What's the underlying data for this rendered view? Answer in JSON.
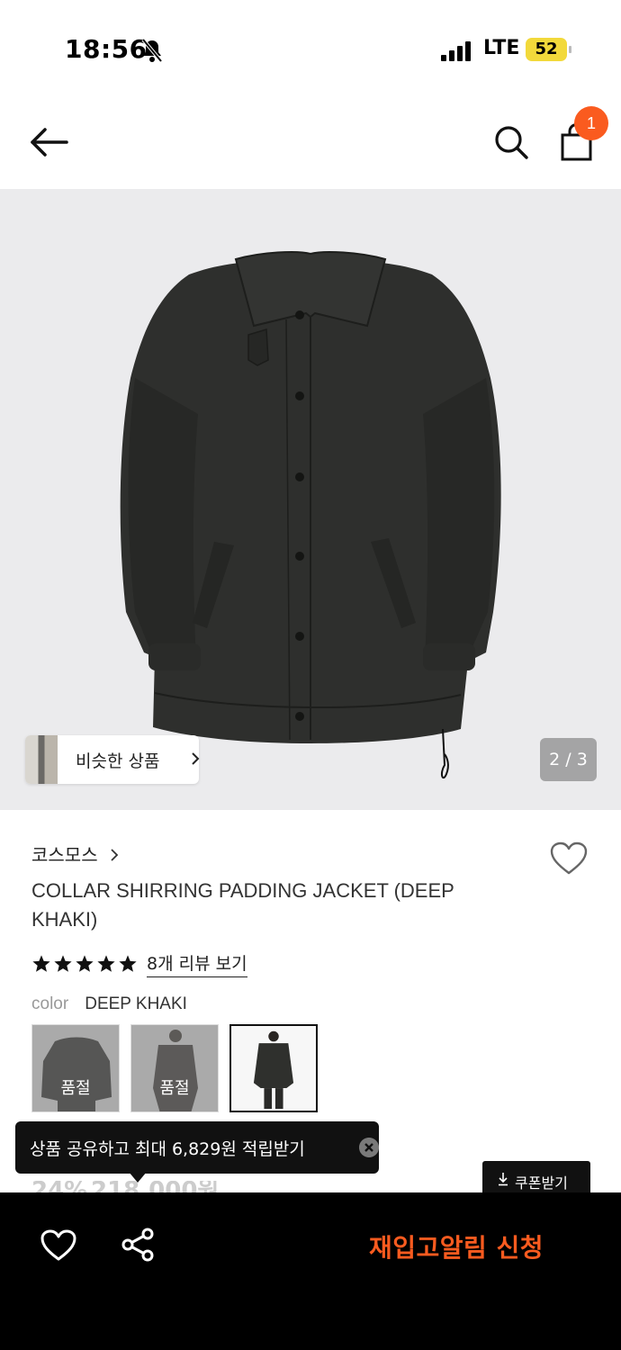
{
  "status_bar": {
    "time": "18:56",
    "network": "LTE",
    "battery": "52",
    "icons": [
      "bell-slash-icon",
      "signal-icon"
    ]
  },
  "nav": {
    "icons": [
      "back-arrow-icon",
      "search-icon",
      "shopping-bag-icon"
    ],
    "cart_count": "1"
  },
  "gallery": {
    "similar_label": "비슷한 상품",
    "counter": "2 / 3"
  },
  "product": {
    "brand": "코스모스",
    "title": "COLLAR SHIRRING PADDING JACKET (DEEP KHAKI)",
    "rating_stars": 5,
    "review_link": "8개 리뷰 보기",
    "color_label": "color",
    "color_value": "DEEP KHAKI",
    "swatches": [
      {
        "state": "품절"
      },
      {
        "state": "품절"
      },
      {
        "state": ""
      }
    ]
  },
  "tooltip": {
    "text": "상품 공유하고 최대 6,829원 적립받기"
  },
  "coupon": {
    "label": "쿠폰받기"
  },
  "price_peek": {
    "discount": "24%",
    "price": "218,000원"
  },
  "bottom_bar": {
    "restock_label": "재입고알림 신청",
    "accent_color": "#fa5b1f"
  }
}
